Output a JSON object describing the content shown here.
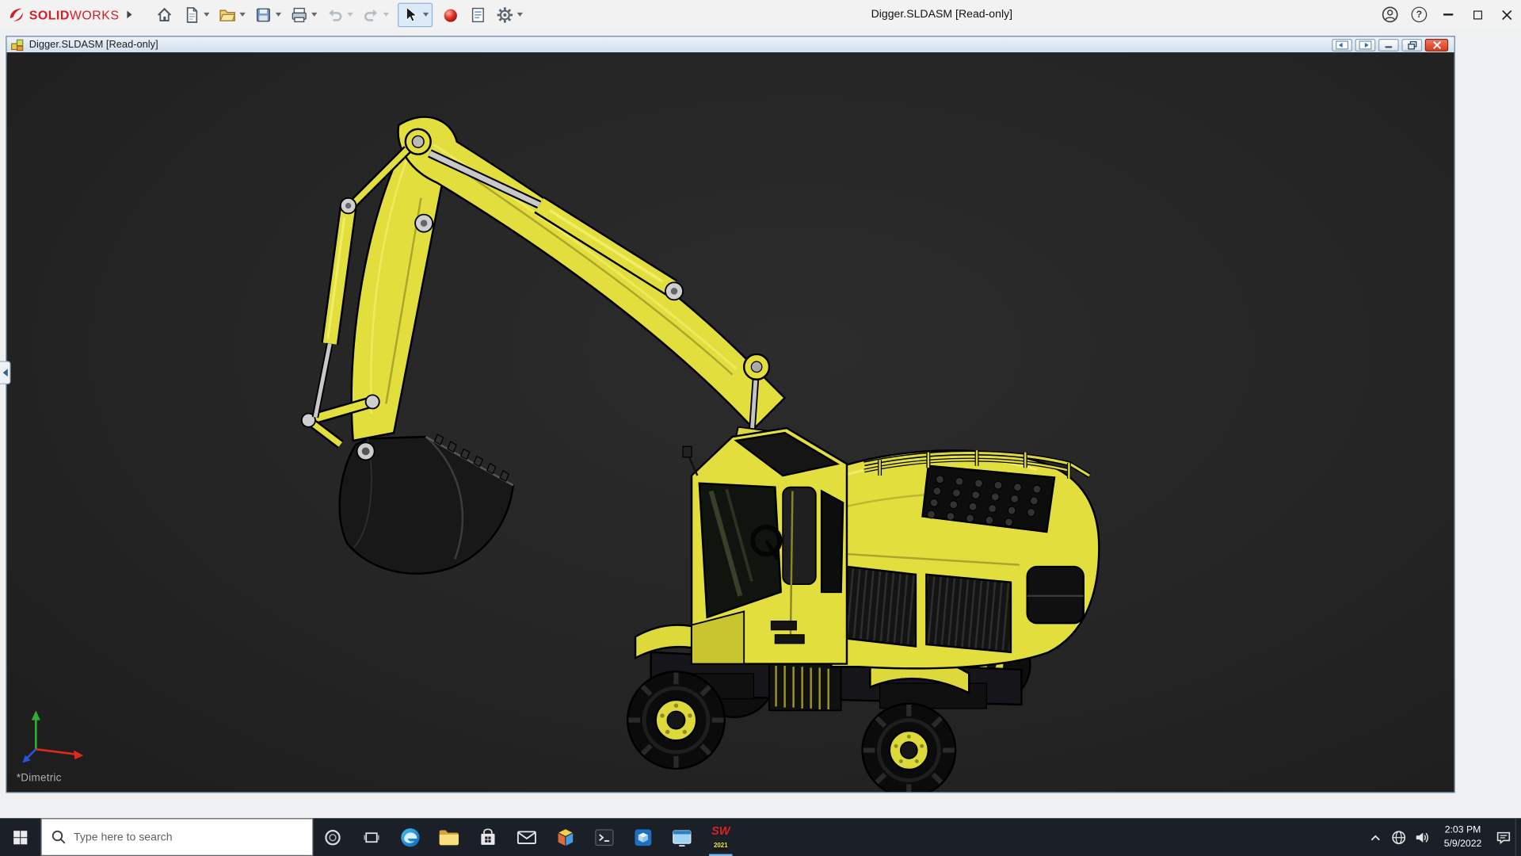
{
  "app": {
    "brand_solid": "SOLID",
    "brand_works": "WORKS",
    "title": "Digger.SLDASM [Read-only]",
    "help_glyph": "?",
    "toolbar_icons": [
      "home",
      "new-document",
      "open",
      "save",
      "print",
      "undo",
      "redo",
      "select",
      "appearances",
      "file-properties",
      "options"
    ]
  },
  "doc": {
    "title": "Digger.SLDASM [Read-only]",
    "orientation_label": "*Dimetric"
  },
  "taskbar": {
    "search_placeholder": "Type here to search",
    "clock_time": "2:03 PM",
    "clock_date": "5/9/2022",
    "solidworks_letters": "SW",
    "solidworks_badge": "2021",
    "app_icons": [
      "start",
      "search",
      "cortana",
      "task-view",
      "edge",
      "file-explorer",
      "microsoft-store",
      "mail",
      "3d-viewer",
      "command-prompt",
      "solidworks-tools",
      "remote-window",
      "solidworks-2021"
    ],
    "tray_icons": [
      "hidden-icons-chevron",
      "network",
      "volume",
      "clock",
      "action-center",
      "show-desktop"
    ]
  },
  "colors": {
    "model_yellow": "#e2de3e",
    "viewport_background": "#262626",
    "taskbar_background": "#1b1f27",
    "doc_close_red": "#d93a1e",
    "brand_red": "#d22027"
  }
}
